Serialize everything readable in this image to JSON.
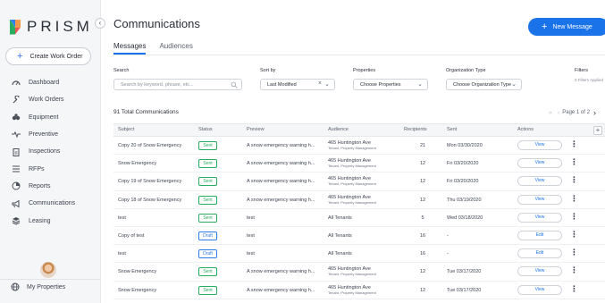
{
  "brand": {
    "name": "PRISM"
  },
  "sidebar": {
    "collapse_label": "‹",
    "create_button": {
      "icon": "+",
      "label": "Create Work Order"
    },
    "items": [
      {
        "key": "dashboard",
        "label": "Dashboard",
        "icon": "gauge-icon"
      },
      {
        "key": "work-orders",
        "label": "Work Orders",
        "icon": "wrench-icon"
      },
      {
        "key": "equipment",
        "label": "Equipment",
        "icon": "equipment-icon"
      },
      {
        "key": "preventive",
        "label": "Preventive",
        "icon": "preventive-icon"
      },
      {
        "key": "inspections",
        "label": "Inspections",
        "icon": "clipboard-icon"
      },
      {
        "key": "rfps",
        "label": "RFPs",
        "icon": "list-icon"
      },
      {
        "key": "reports",
        "label": "Reports",
        "icon": "reports-icon"
      },
      {
        "key": "communications",
        "label": "Communications",
        "icon": "megaphone-icon"
      },
      {
        "key": "leasing",
        "label": "Leasing",
        "icon": "layers-icon"
      }
    ],
    "footer": {
      "label": "My Properties",
      "icon": "globe-icon"
    }
  },
  "header": {
    "title": "Communications",
    "new_message": {
      "icon": "+",
      "label": "New Message"
    }
  },
  "tabs": [
    {
      "label": "Messages",
      "active": true
    },
    {
      "label": "Audiences",
      "active": false
    }
  ],
  "filters": {
    "search": {
      "label": "Search",
      "placeholder": "Search by keyword, phrase, etc..."
    },
    "sort": {
      "label": "Sort by",
      "value": "Last Modified"
    },
    "properties": {
      "label": "Properties",
      "value": "Choose Properties"
    },
    "org_type": {
      "label": "Organization Type",
      "value": "Choose Organization Type"
    },
    "filters": {
      "label": "Filters",
      "applied": "0 Filters Applied"
    }
  },
  "summary": {
    "total": "91 Total Communications",
    "page": "Page 1 of 2"
  },
  "table": {
    "columns": [
      "Subject",
      "Status",
      "Preview",
      "Audience",
      "Recipients",
      "Sent",
      "Actions"
    ],
    "rows": [
      {
        "subject": "Copy 20 of Snow Emergency",
        "status": "Sent",
        "preview": "A snow emergency warning h...",
        "audience": "465 Huntington Ave",
        "audience_sub": "Tenant, Property Management",
        "recipients": "21",
        "sent": "Mon 03/30/2020",
        "action": "View"
      },
      {
        "subject": "Snow Emergency",
        "status": "Sent",
        "preview": "A snow emergency warning h...",
        "audience": "465 Huntington Ave",
        "audience_sub": "Tenant, Property Management",
        "recipients": "12",
        "sent": "Fri 03/20/2020",
        "action": "View"
      },
      {
        "subject": "Copy 19 of Snow Emergency",
        "status": "Sent",
        "preview": "A snow emergency warning h...",
        "audience": "465 Huntington Ave",
        "audience_sub": "Tenant, Property Management",
        "recipients": "12",
        "sent": "Fri 03/20/2020",
        "action": "View"
      },
      {
        "subject": "Copy 18 of Snow Emergency",
        "status": "Sent",
        "preview": "A snow emergency warning h...",
        "audience": "465 Huntington Ave",
        "audience_sub": "Tenant, Property Management",
        "recipients": "12",
        "sent": "Thu 03/19/2020",
        "action": "View"
      },
      {
        "subject": "test",
        "status": "Sent",
        "preview": "test",
        "audience": "All Tenants",
        "audience_sub": "",
        "recipients": "5",
        "sent": "Wed 03/18/2020",
        "action": "View"
      },
      {
        "subject": "Copy of test",
        "status": "Draft",
        "preview": "test",
        "audience": "All Tenants",
        "audience_sub": "",
        "recipients": "16",
        "sent": "-",
        "action": "Edit"
      },
      {
        "subject": "test",
        "status": "Draft",
        "preview": "test",
        "audience": "All Tenants",
        "audience_sub": "",
        "recipients": "16",
        "sent": "-",
        "action": "Edit"
      },
      {
        "subject": "Snow Emergency",
        "status": "Sent",
        "preview": "A snow emergency warning h...",
        "audience": "465 Huntington Ave",
        "audience_sub": "Tenant, Property Management",
        "recipients": "12",
        "sent": "Tue 03/17/2020",
        "action": "View"
      },
      {
        "subject": "Snow Emergency",
        "status": "Sent",
        "preview": "A snow emergency warning h...",
        "audience": "465 Huntington Ave",
        "audience_sub": "Tenant, Property Management",
        "recipients": "12",
        "sent": "Tue 03/17/2020",
        "action": "View"
      }
    ]
  },
  "colors": {
    "primary": "#1a73e8",
    "sent": "#27ae60",
    "draft": "#2f80ed",
    "sidebar_bg": "#f5f6f8"
  }
}
